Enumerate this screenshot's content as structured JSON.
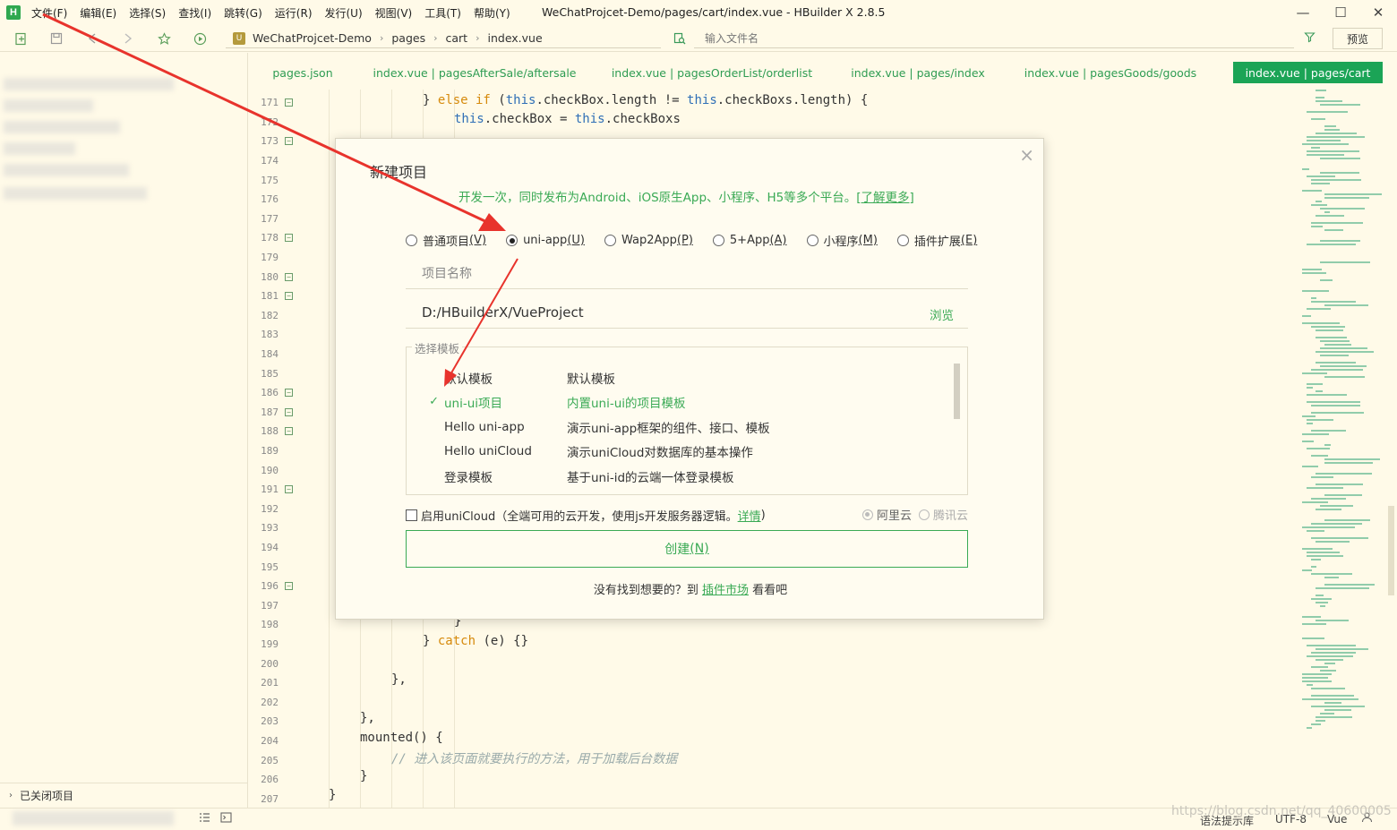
{
  "app": {
    "logo": "H",
    "window_title": "WeChatProjcet-Demo/pages/cart/index.vue - HBuilder X 2.8.5"
  },
  "menu": [
    "文件(F)",
    "编辑(E)",
    "选择(S)",
    "查找(I)",
    "跳转(G)",
    "运行(R)",
    "发行(U)",
    "视图(V)",
    "工具(T)",
    "帮助(Y)"
  ],
  "window_controls": {
    "minimize": "—",
    "maximize": "☐",
    "close": "✕"
  },
  "toolbar": {
    "breadcrumb_icon": "U",
    "breadcrumb": [
      "WeChatProjcet-Demo",
      "pages",
      "cart",
      "index.vue"
    ],
    "file_search_placeholder": "输入文件名",
    "preview_label": "预览"
  },
  "sidebar": {
    "closed_projects": "已关闭项目"
  },
  "tabs": [
    {
      "label": "pages.json",
      "active": false
    },
    {
      "label": "index.vue | pagesAfterSale/aftersale",
      "active": false
    },
    {
      "label": "index.vue | pagesOrderList/orderlist",
      "active": false
    },
    {
      "label": "index.vue | pages/index",
      "active": false
    },
    {
      "label": "index.vue | pagesGoods/goods",
      "active": false
    },
    {
      "label": "index.vue | pages/cart",
      "active": true
    }
  ],
  "editor": {
    "line_numbers": [
      "171",
      "172",
      "173",
      "174",
      "175",
      "176",
      "177",
      "178",
      "179",
      "180",
      "181",
      "182",
      "183",
      "184",
      "185",
      "186",
      "187",
      "188",
      "189",
      "190",
      "191",
      "192",
      "193",
      "194",
      "195",
      "196",
      "197",
      "198",
      "199",
      "200",
      "201",
      "202",
      "203",
      "204",
      "205",
      "206",
      "207"
    ],
    "folded_lines": [
      "171",
      "173",
      "178",
      "180",
      "181",
      "186",
      "187",
      "188",
      "191",
      "196"
    ],
    "code": {
      "l171_a": "} ",
      "l171_else": "else if",
      "l171_b": " (",
      "l171_this1": "this",
      "l171_c": ".checkBox.length != ",
      "l171_this2": "this",
      "l171_d": ".checkBoxs.length) {",
      "l172_this1": "this",
      "l172_a": ".checkBox = ",
      "l172_this2": "this",
      "l172_b": ".checkBoxs",
      "l198": "}",
      "l199_a": "} ",
      "l199_catch": "catch",
      "l199_b": " (e) {}",
      "l201": "},",
      "l203": "},",
      "l204": "mounted() {",
      "l205": "// 进入该页面就要执行的方法，用于加载后台数据",
      "l206": "}",
      "l207": "}"
    }
  },
  "dialog": {
    "title": "新建项目",
    "close": "×",
    "subtitle": "开发一次，同时发布为Android、iOS原生App、小程序、H5等多个平台。",
    "learn_more": "[了解更多]",
    "project_types": [
      {
        "label": "普通项目",
        "key": "(V)",
        "selected": false
      },
      {
        "label": "uni-app",
        "key": "(U)",
        "selected": true
      },
      {
        "label": "Wap2App",
        "key": "(P)",
        "selected": false
      },
      {
        "label": "5+App",
        "key": "(A)",
        "selected": false
      },
      {
        "label": "小程序",
        "key": "(M)",
        "selected": false
      },
      {
        "label": "插件扩展",
        "key": "(E)",
        "selected": false
      }
    ],
    "name_placeholder": "项目名称",
    "path": "D:/HBuilderX/VueProject",
    "browse": "浏览",
    "template_legend": "选择模板",
    "templates": [
      {
        "name": "默认模板",
        "desc": "默认模板",
        "selected": false
      },
      {
        "name": "uni-ui项目",
        "desc": "内置uni-ui的项目模板",
        "selected": true
      },
      {
        "name": "Hello uni-app",
        "desc": "演示uni-app框架的组件、接口、模板",
        "selected": false
      },
      {
        "name": "Hello uniCloud",
        "desc": "演示uniCloud对数据库的基本操作",
        "selected": false
      },
      {
        "name": "登录模板",
        "desc": "基于uni-id的云端一体登录模板",
        "selected": false
      }
    ],
    "check_mark": "✓",
    "unicloud_label": "启用uniCloud（全端可用的云开发，使用js开发服务器逻辑。",
    "unicloud_detail": "详情",
    "unicloud_close": ")",
    "cloud_aliyun": "阿里云",
    "cloud_tencent": "腾讯云",
    "create_label": "创建",
    "create_key": "(N)",
    "footer_pre": "没有找到想要的？到 ",
    "footer_link": "插件市场",
    "footer_post": " 看看吧"
  },
  "statusbar": {
    "syntax_hint": "语法提示库",
    "encoding": "UTF-8",
    "language": "Vue",
    "watermark": "https://blog.csdn.net/qq_40600005"
  },
  "colors": {
    "accent": "#1ba456",
    "link_green": "#3aaa55",
    "keyword": "#d68a0c",
    "this": "#2f6fb6",
    "annotation_arrow": "#e8332c",
    "background": "#fffae8"
  }
}
